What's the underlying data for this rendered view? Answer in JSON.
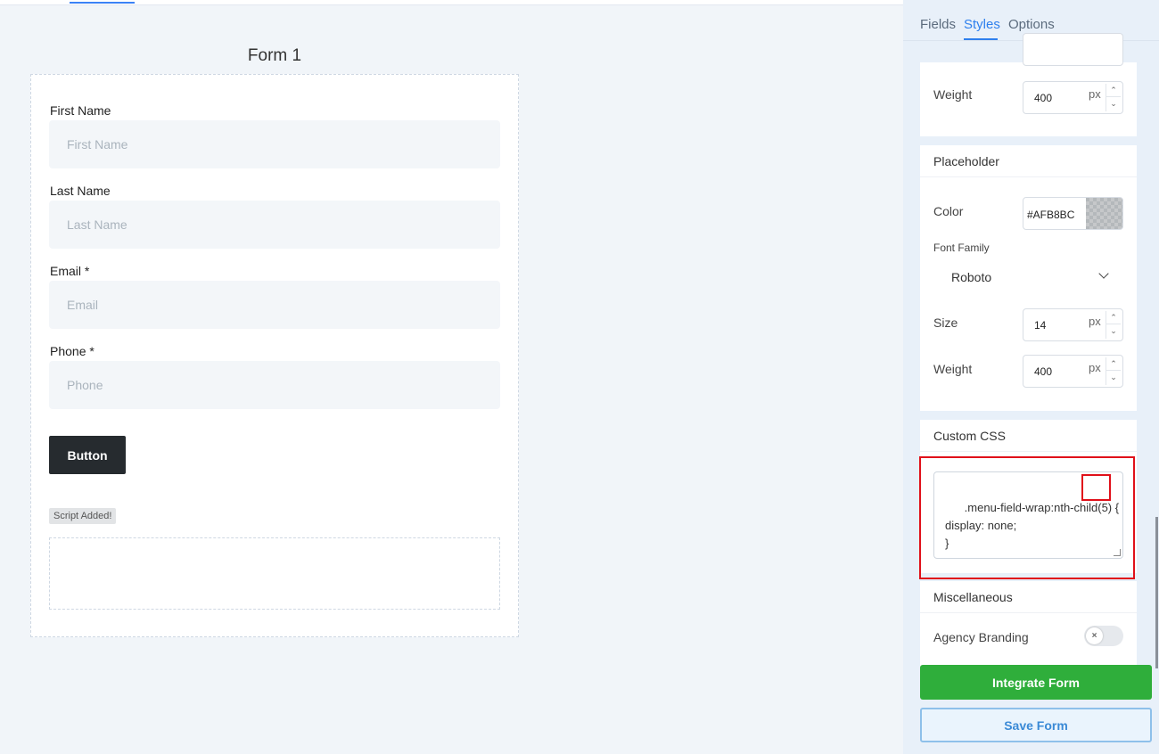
{
  "form": {
    "title": "Form 1",
    "fields": [
      {
        "label": "First Name",
        "placeholder": "First Name"
      },
      {
        "label": "Last Name",
        "placeholder": "Last Name"
      },
      {
        "label": "Email *",
        "placeholder": "Email"
      },
      {
        "label": "Phone *",
        "placeholder": "Phone"
      }
    ],
    "button_label": "Button",
    "script_badge": "Script Added!"
  },
  "panel": {
    "tabs": [
      "Fields",
      "Styles",
      "Options"
    ],
    "active_tab": "Styles",
    "label_section": {
      "weight_label": "Weight",
      "weight_value": "400",
      "unit": "px"
    },
    "placeholder_section": {
      "header": "Placeholder",
      "color_label": "Color",
      "color_value": "#AFB8BC",
      "font_family_label": "Font Family",
      "font_family_value": "Roboto",
      "size_label": "Size",
      "size_value": "14",
      "weight_label": "Weight",
      "weight_value": "400",
      "unit": "px"
    },
    "custom_css": {
      "header": "Custom CSS",
      "code": ".menu-field-wrap:nth-child(5) {\ndisplay: none;\n}"
    },
    "misc": {
      "header": "Miscellaneous",
      "agency_branding_label": "Agency Branding",
      "toggle_icon": "×"
    },
    "integrate_label": "Integrate Form",
    "save_label": "Save Form"
  },
  "colors": {
    "accent": "#2f80ed",
    "integrate": "#2fae3b",
    "highlight": "#e0101a",
    "swatch": "#AFB8BC"
  }
}
